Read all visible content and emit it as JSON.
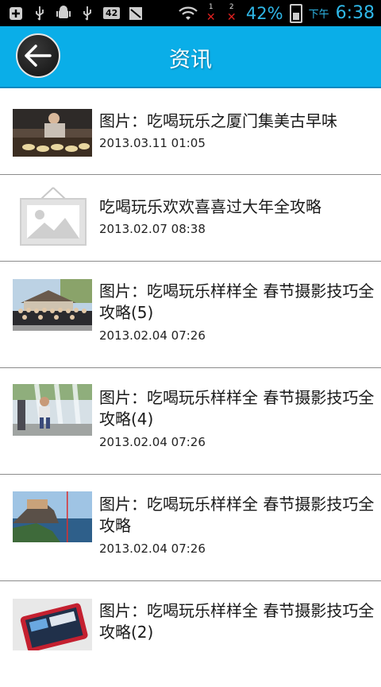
{
  "status_bar": {
    "battery": "42%",
    "notif_badge": "42",
    "sim1": "1",
    "sim2": "2",
    "ampm": "下午",
    "time": "6:38"
  },
  "header": {
    "title": "资讯"
  },
  "news": [
    {
      "title": "图片：吃喝玩乐之厦门集美古早味",
      "date": "2013.03.11 01:05"
    },
    {
      "title": "吃喝玩乐欢欢喜喜过大年全攻略",
      "date": "2013.02.07 08:38"
    },
    {
      "title": "图片：吃喝玩乐样样全 春节摄影技巧全攻略(5)",
      "date": "2013.02.04 07:26"
    },
    {
      "title": "图片：吃喝玩乐样样全 春节摄影技巧全攻略(4)",
      "date": "2013.02.04 07:26"
    },
    {
      "title": "图片：吃喝玩乐样样全 春节摄影技巧全攻略",
      "date": "2013.02.04 07:26"
    },
    {
      "title": "图片：吃喝玩乐样样全 春节摄影技巧全攻略(2)",
      "date": ""
    }
  ],
  "colors": {
    "header": "#0aaee8",
    "statusbar": "#000000",
    "status_text": "#2fb8e8"
  }
}
